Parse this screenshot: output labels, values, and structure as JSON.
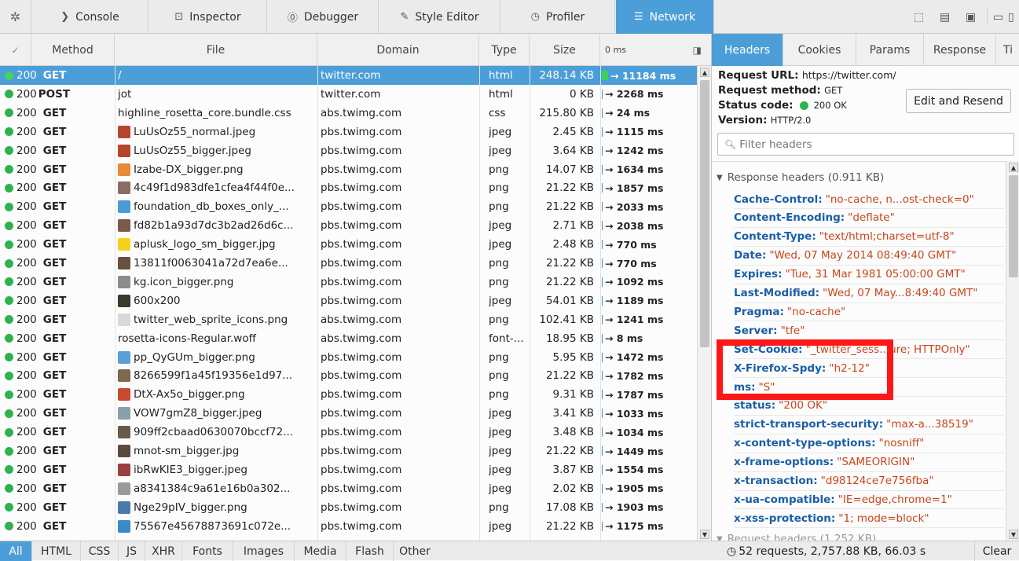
{
  "toolbar": {
    "tabs": [
      {
        "label": "Console",
        "icon": "prompt-icon"
      },
      {
        "label": "Inspector",
        "icon": "inspector-icon"
      },
      {
        "label": "Debugger",
        "icon": "debugger-icon"
      },
      {
        "label": "Style Editor",
        "icon": "pencil-icon"
      },
      {
        "label": "Profiler",
        "icon": "clock-icon"
      },
      {
        "label": "Network",
        "icon": "network-icon"
      }
    ],
    "active_tab": "Network",
    "accent": "#4c9ed9"
  },
  "columns": {
    "method": "Method",
    "file": "File",
    "domain": "Domain",
    "type": "Type",
    "size": "Size",
    "waterfall": "0 ms"
  },
  "requests": [
    {
      "code": "200",
      "method": "GET",
      "file": "/",
      "domain": "twitter.com",
      "type": "html",
      "size": "248.14 KB",
      "time": "→ 11184 ms",
      "thumb": ""
    },
    {
      "code": "200",
      "method": "POST",
      "file": "jot",
      "domain": "twitter.com",
      "type": "html",
      "size": "0 KB",
      "time": "→ 2268 ms",
      "thumb": ""
    },
    {
      "code": "200",
      "method": "GET",
      "file": "highline_rosetta_core.bundle.css",
      "domain": "abs.twimg.com",
      "type": "css",
      "size": "215.80 KB",
      "time": "→ 24 ms",
      "thumb": ""
    },
    {
      "code": "200",
      "method": "GET",
      "file": "LuUsOz55_normal.jpeg",
      "domain": "pbs.twimg.com",
      "type": "jpeg",
      "size": "2.45 KB",
      "time": "→ 1115 ms",
      "thumb": "#b8442c"
    },
    {
      "code": "200",
      "method": "GET",
      "file": "LuUsOz55_bigger.jpeg",
      "domain": "pbs.twimg.com",
      "type": "jpeg",
      "size": "3.64 KB",
      "time": "→ 1242 ms",
      "thumb": "#b8442c"
    },
    {
      "code": "200",
      "method": "GET",
      "file": "Izabe-DX_bigger.png",
      "domain": "pbs.twimg.com",
      "type": "png",
      "size": "14.07 KB",
      "time": "→ 1634 ms",
      "thumb": "#e8883a"
    },
    {
      "code": "200",
      "method": "GET",
      "file": "4c49f1d983dfe1cfea4f44f0e...",
      "domain": "pbs.twimg.com",
      "type": "png",
      "size": "21.22 KB",
      "time": "→ 1857 ms",
      "thumb": "#8a6d60"
    },
    {
      "code": "200",
      "method": "GET",
      "file": "foundation_db_boxes_only_...",
      "domain": "pbs.twimg.com",
      "type": "png",
      "size": "21.22 KB",
      "time": "→ 2033 ms",
      "thumb": "#4a9bd6"
    },
    {
      "code": "200",
      "method": "GET",
      "file": "fd82b1a93d7dc3b2ad26d6c...",
      "domain": "pbs.twimg.com",
      "type": "jpeg",
      "size": "2.71 KB",
      "time": "→ 2038 ms",
      "thumb": "#7b5a4a"
    },
    {
      "code": "200",
      "method": "GET",
      "file": "aplusk_logo_sm_bigger.jpg",
      "domain": "pbs.twimg.com",
      "type": "jpeg",
      "size": "2.48 KB",
      "time": "→ 770 ms",
      "thumb": "#f3d21b"
    },
    {
      "code": "200",
      "method": "GET",
      "file": "13811f0063041a72d7ea6e...",
      "domain": "pbs.twimg.com",
      "type": "png",
      "size": "21.22 KB",
      "time": "→ 770 ms",
      "thumb": "#6a5042"
    },
    {
      "code": "200",
      "method": "GET",
      "file": "kg.icon_bigger.png",
      "domain": "pbs.twimg.com",
      "type": "png",
      "size": "21.22 KB",
      "time": "→ 1092 ms",
      "thumb": "#8c8c8c"
    },
    {
      "code": "200",
      "method": "GET",
      "file": "600x200",
      "domain": "pbs.twimg.com",
      "type": "jpeg",
      "size": "54.01 KB",
      "time": "→ 1189 ms",
      "thumb": "#3a3a2a"
    },
    {
      "code": "200",
      "method": "GET",
      "file": "twitter_web_sprite_icons.png",
      "domain": "abs.twimg.com",
      "type": "png",
      "size": "102.41 KB",
      "time": "→ 1241 ms",
      "thumb": "#d8d8d8"
    },
    {
      "code": "200",
      "method": "GET",
      "file": "rosetta-icons-Regular.woff",
      "domain": "abs.twimg.com",
      "type": "font-...",
      "size": "18.95 KB",
      "time": "→ 8 ms",
      "thumb": ""
    },
    {
      "code": "200",
      "method": "GET",
      "file": "pp_QyGUm_bigger.png",
      "domain": "pbs.twimg.com",
      "type": "png",
      "size": "5.95 KB",
      "time": "→ 1472 ms",
      "thumb": "#5a9fd5"
    },
    {
      "code": "200",
      "method": "GET",
      "file": "8266599f1a45f19356e1d97...",
      "domain": "pbs.twimg.com",
      "type": "png",
      "size": "21.22 KB",
      "time": "→ 1782 ms",
      "thumb": "#7a6a50"
    },
    {
      "code": "200",
      "method": "GET",
      "file": "DtX-Ax5o_bigger.png",
      "domain": "pbs.twimg.com",
      "type": "png",
      "size": "9.31 KB",
      "time": "→ 1787 ms",
      "thumb": "#c84a30"
    },
    {
      "code": "200",
      "method": "GET",
      "file": "VOW7gmZ8_bigger.jpeg",
      "domain": "pbs.twimg.com",
      "type": "jpeg",
      "size": "3.41 KB",
      "time": "→ 1033 ms",
      "thumb": "#8aa0a8"
    },
    {
      "code": "200",
      "method": "GET",
      "file": "909ff2cbaad0630070bccf72...",
      "domain": "pbs.twimg.com",
      "type": "jpeg",
      "size": "3.48 KB",
      "time": "→ 1034 ms",
      "thumb": "#6a5a4a"
    },
    {
      "code": "200",
      "method": "GET",
      "file": "mnot-sm_bigger.jpg",
      "domain": "pbs.twimg.com",
      "type": "jpeg",
      "size": "21.22 KB",
      "time": "→ 1449 ms",
      "thumb": "#5a4a40"
    },
    {
      "code": "200",
      "method": "GET",
      "file": "ibRwKIE3_bigger.jpeg",
      "domain": "pbs.twimg.com",
      "type": "jpeg",
      "size": "3.87 KB",
      "time": "→ 1554 ms",
      "thumb": "#9a4040"
    },
    {
      "code": "200",
      "method": "GET",
      "file": "a8341384c9a61e16b0a302...",
      "domain": "pbs.twimg.com",
      "type": "jpeg",
      "size": "2.02 KB",
      "time": "→ 1905 ms",
      "thumb": "#9a9a9a"
    },
    {
      "code": "200",
      "method": "GET",
      "file": "Nge29pIV_bigger.png",
      "domain": "pbs.twimg.com",
      "type": "png",
      "size": "17.08 KB",
      "time": "→ 1903 ms",
      "thumb": "#4a7aa8"
    },
    {
      "code": "200",
      "method": "GET",
      "file": "75567e45678873691c072e...",
      "domain": "pbs.twimg.com",
      "type": "jpeg",
      "size": "21.22 KB",
      "time": "→ 1175 ms",
      "thumb": "#3a8ac8"
    }
  ],
  "details": {
    "tabs": [
      "Headers",
      "Cookies",
      "Params",
      "Response",
      "Ti"
    ],
    "active_tab": "Headers",
    "request_url_label": "Request URL:",
    "request_url": "https://twitter.com/",
    "request_method_label": "Request method:",
    "request_method": "GET",
    "status_code_label": "Status code:",
    "status_code": "200 OK",
    "version_label": "Version:",
    "version": "HTTP/2.0",
    "resend_label": "Edit and Resend",
    "filter_placeholder": "Filter headers",
    "response_section": "Response headers (0.911 KB)",
    "request_section": "Request headers (1.252 KB)",
    "response_headers": [
      {
        "name": "Cache-Control",
        "value": "\"no-cache, n...ost-check=0\""
      },
      {
        "name": "Content-Encoding",
        "value": "\"deflate\""
      },
      {
        "name": "Content-Type",
        "value": "\"text/html;charset=utf-8\""
      },
      {
        "name": "Date",
        "value": "\"Wed, 07 May 2014 08:49:40 GMT\""
      },
      {
        "name": "Expires",
        "value": "\"Tue, 31 Mar 1981 05:00:00 GMT\""
      },
      {
        "name": "Last-Modified",
        "value": "\"Wed, 07 May...8:49:40 GMT\""
      },
      {
        "name": "Pragma",
        "value": "\"no-cache\""
      },
      {
        "name": "Server",
        "value": "\"tfe\""
      },
      {
        "name": "Set-Cookie",
        "value": "\"_twitter_sess...ure; HTTPOnly\""
      },
      {
        "name": "X-Firefox-Spdy",
        "value": "\"h2-12\""
      },
      {
        "name": "ms",
        "value": "\"S\""
      },
      {
        "name": "status",
        "value": "\"200 OK\""
      },
      {
        "name": "strict-transport-security",
        "value": "\"max-a...38519\""
      },
      {
        "name": "x-content-type-options",
        "value": "\"nosniff\""
      },
      {
        "name": "x-frame-options",
        "value": "\"SAMEORIGIN\""
      },
      {
        "name": "x-transaction",
        "value": "\"d98124ce7e756fba\""
      },
      {
        "name": "x-ua-compatible",
        "value": "\"IE=edge,chrome=1\""
      },
      {
        "name": "x-xss-protection",
        "value": "\"1; mode=block\""
      }
    ]
  },
  "filters": [
    "All",
    "HTML",
    "CSS",
    "JS",
    "XHR",
    "Fonts",
    "Images",
    "Media",
    "Flash",
    "Other"
  ],
  "active_filter": "All",
  "summary": "52 requests, 2,757.88 KB, 66.03 s",
  "clear_label": "Clear",
  "highlight_color": "#ff1616"
}
